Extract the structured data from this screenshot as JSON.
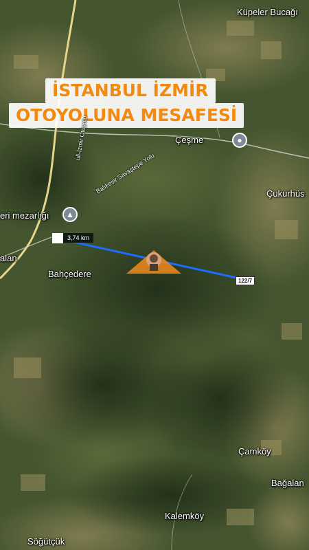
{
  "title": {
    "line1": "İSTANBUL İZMİR",
    "line2": "OTOYOLUNA MESAFESİ"
  },
  "places": {
    "kupeler": "Küpeler Bucağı",
    "cesme": "Çeşme",
    "cukurhus": "Çukurhüs",
    "mezarligi": "eri mezarlığı",
    "alan": "alan",
    "bahcedere": "Bahçedere",
    "camkoy": "Çamköy",
    "bagalan": "Bağalan",
    "kalemkoy": "Kalemköy",
    "sogutcuk": "Söğütçük"
  },
  "roads": {
    "otoyolu": "uli-İzmir Otoyolu",
    "savastepe": "Balıkesir Savaştepe Yolu"
  },
  "measure": {
    "distance": "3,74 km",
    "road_badge": "122/7"
  },
  "colors": {
    "title_text": "#f28a12",
    "measure_line": "#1e6cff",
    "pin": "#f08a1e",
    "highway": "#e6d58a"
  },
  "icons": {
    "poi": "cemetery-icon",
    "cesme_marker": "location-dot-icon",
    "pin": "logo-pin-icon"
  }
}
